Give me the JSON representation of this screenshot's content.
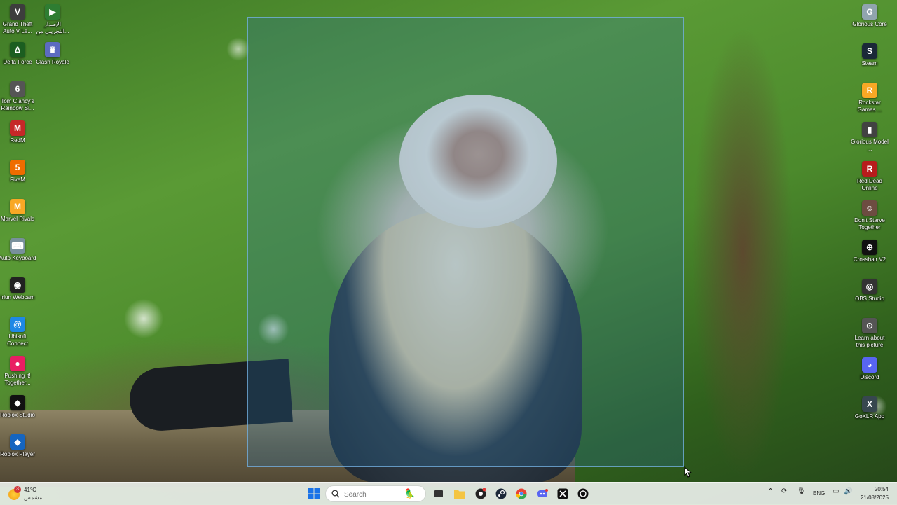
{
  "desktop": {
    "left_icons": [
      {
        "label": "Grand Theft Auto V Le...",
        "icon": "gta-icon",
        "color": "#3d3d3d",
        "glyph": "V"
      },
      {
        "label": "الإصدار التجريبي من...",
        "icon": "xbox-beta-icon",
        "color": "#2e7d32",
        "glyph": "▶"
      },
      {
        "label": "Delta Force",
        "icon": "delta-force-icon",
        "color": "#1b5e20",
        "glyph": "Δ"
      },
      {
        "label": "Clash Royale",
        "icon": "clash-royale-icon",
        "color": "#5c6bc0",
        "glyph": "♛"
      },
      {
        "label": "Tom Clancy's Rainbow Si...",
        "icon": "rainbow-six-icon",
        "color": "#555555",
        "glyph": "6"
      },
      {
        "label": "RedM",
        "icon": "redm-icon",
        "color": "#c62828",
        "glyph": "M"
      },
      {
        "label": "FiveM",
        "icon": "fivem-icon",
        "color": "#ef6c00",
        "glyph": "5"
      },
      {
        "label": "Marvel Rivals",
        "icon": "marvel-rivals-icon",
        "color": "#f9a825",
        "glyph": "M"
      },
      {
        "label": "Auto Keyboard",
        "icon": "auto-keyboard-icon",
        "color": "#78909c",
        "glyph": "⌨"
      },
      {
        "label": "Iriun Webcam",
        "icon": "iriun-webcam-icon",
        "color": "#212121",
        "glyph": "◉"
      },
      {
        "label": "Ubisoft Connect",
        "icon": "ubisoft-connect-icon",
        "color": "#1e88e5",
        "glyph": "@"
      },
      {
        "label": "Pushing it! Together...",
        "icon": "pushing-it-icon",
        "color": "#e91e63",
        "glyph": "●"
      },
      {
        "label": "Roblox Studio",
        "icon": "roblox-studio-icon",
        "color": "#111111",
        "glyph": "◆"
      },
      {
        "label": "Roblox Player",
        "icon": "roblox-player-icon",
        "color": "#1565c0",
        "glyph": "◆"
      }
    ],
    "right_icons": [
      {
        "label": "Glorious Core",
        "icon": "glorious-core-icon",
        "color": "#90a4ae",
        "glyph": "G"
      },
      {
        "label": "Steam",
        "icon": "steam-icon",
        "color": "#1b2838",
        "glyph": "S"
      },
      {
        "label": "Rockstar Games ...",
        "icon": "rockstar-games-icon",
        "color": "#f9a825",
        "glyph": "R"
      },
      {
        "label": "Glorious Model ...",
        "icon": "glorious-model-icon",
        "color": "#424242",
        "glyph": "▮"
      },
      {
        "label": "Red Dead Online",
        "icon": "red-dead-online-icon",
        "color": "#b71c1c",
        "glyph": "R"
      },
      {
        "label": "Don't Starve Together",
        "icon": "dont-starve-icon",
        "color": "#6d4c41",
        "glyph": "☺"
      },
      {
        "label": "Crosshair V2",
        "icon": "crosshair-icon",
        "color": "#111111",
        "glyph": "⊕"
      },
      {
        "label": "OBS Studio",
        "icon": "obs-studio-icon",
        "color": "#333333",
        "glyph": "◎"
      },
      {
        "label": "Learn about this picture",
        "icon": "learn-about-picture-icon",
        "color": "#555555",
        "glyph": "⊙"
      },
      {
        "label": "Discord",
        "icon": "discord-icon",
        "color": "#5865f2",
        "glyph": "◕"
      },
      {
        "label": "GoXLR App",
        "icon": "goxlr-icon",
        "color": "#37474f",
        "glyph": "X"
      }
    ]
  },
  "taskbar": {
    "weather": {
      "temp": "41°C",
      "condition": "مشمس",
      "badge": "3"
    },
    "search": {
      "placeholder": "Search"
    },
    "pinned": [
      {
        "name": "start-button",
        "icon": "windows-logo-icon",
        "color": "#1a73e8"
      },
      {
        "name": "task-view-button",
        "icon": "task-view-icon",
        "color": "#333333"
      },
      {
        "name": "file-explorer-button",
        "icon": "folder-icon",
        "color": "#f4c542"
      },
      {
        "name": "obs-taskbar-button",
        "icon": "obs-icon",
        "color": "#222222"
      },
      {
        "name": "steam-taskbar-button",
        "icon": "steam-icon",
        "color": "#1b2838"
      },
      {
        "name": "chrome-taskbar-button",
        "icon": "chrome-icon",
        "color": "#4285f4"
      },
      {
        "name": "discord-taskbar-button",
        "icon": "discord-icon",
        "color": "#5865f2"
      },
      {
        "name": "capcut-taskbar-button",
        "icon": "capcut-icon",
        "color": "#111111"
      },
      {
        "name": "chatgpt-taskbar-button",
        "icon": "chatgpt-icon",
        "color": "#111111"
      }
    ],
    "tray": {
      "language": "ENG",
      "time": "20:54",
      "date": "21/08/2025"
    }
  }
}
